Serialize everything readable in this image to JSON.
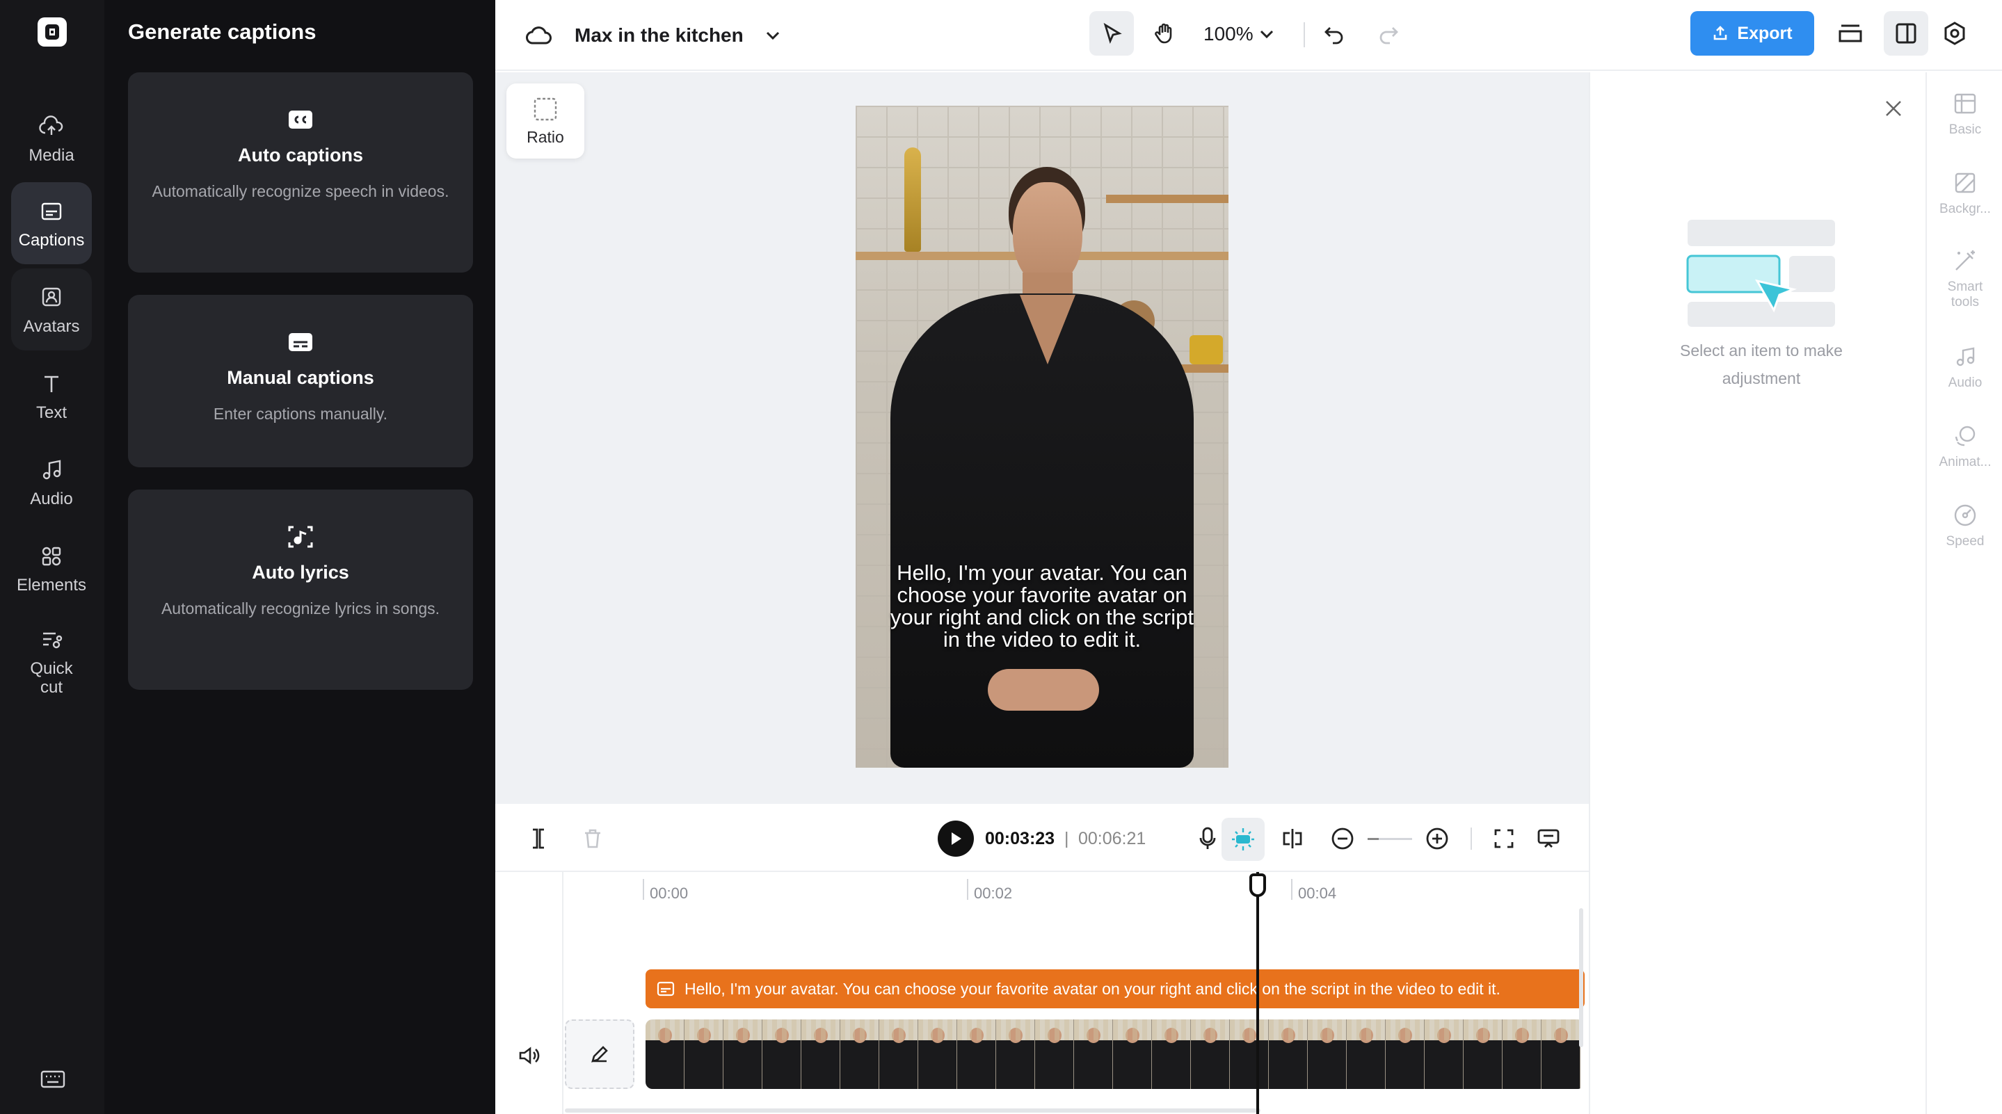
{
  "rail": {
    "items": [
      {
        "label": "Media",
        "icon": "cloud-upload-icon",
        "active": false
      },
      {
        "label": "Captions",
        "icon": "captions-icon",
        "active": true
      },
      {
        "label": "Avatars",
        "icon": "avatar-icon",
        "active": false
      },
      {
        "label": "Text",
        "icon": "text-icon",
        "active": false
      },
      {
        "label": "Audio",
        "icon": "music-note-icon",
        "active": false
      },
      {
        "label": "Elements",
        "icon": "elements-icon",
        "active": false
      },
      {
        "label": "Quick cut",
        "icon": "quick-cut-icon",
        "active": false
      }
    ]
  },
  "panel": {
    "title": "Generate captions",
    "cards": [
      {
        "title": "Auto captions",
        "desc": "Automatically recognize speech in videos.",
        "icon": "cc-icon"
      },
      {
        "title": "Manual captions",
        "desc": "Enter captions manually.",
        "icon": "subtitles-icon"
      },
      {
        "title": "Auto lyrics",
        "desc": "Automatically recognize lyrics in songs.",
        "icon": "music-scan-icon"
      }
    ]
  },
  "topbar": {
    "project_title": "Max in the kitchen",
    "zoom": "100%",
    "export_label": "Export",
    "accent": "#2f8ef0"
  },
  "canvas": {
    "ratio_label": "Ratio",
    "caption_text": "Hello, I'm your avatar. You can choose your favorite avatar on your right and click on the script in the video to edit it."
  },
  "properties": {
    "empty_text": "Select an item to make adjustment",
    "tabs": [
      {
        "label": "Basic",
        "icon": "basic-icon"
      },
      {
        "label": "Backgr...",
        "icon": "background-icon"
      },
      {
        "label": "Smart tools",
        "icon": "magic-wand-icon"
      },
      {
        "label": "Audio",
        "icon": "music-note-icon"
      },
      {
        "label": "Animat...",
        "icon": "animation-icon"
      },
      {
        "label": "Speed",
        "icon": "speed-icon"
      }
    ]
  },
  "player": {
    "current_time": "00:03:23",
    "separator": "|",
    "total_time": "00:06:21"
  },
  "timeline": {
    "ticks": [
      "00:00",
      "00:02",
      "00:04"
    ],
    "caption_clip_text": "Hello, I'm your avatar. You can choose your favorite avatar on your right and click on the script in the video to edit it.",
    "caption_color": "#e8721c"
  }
}
